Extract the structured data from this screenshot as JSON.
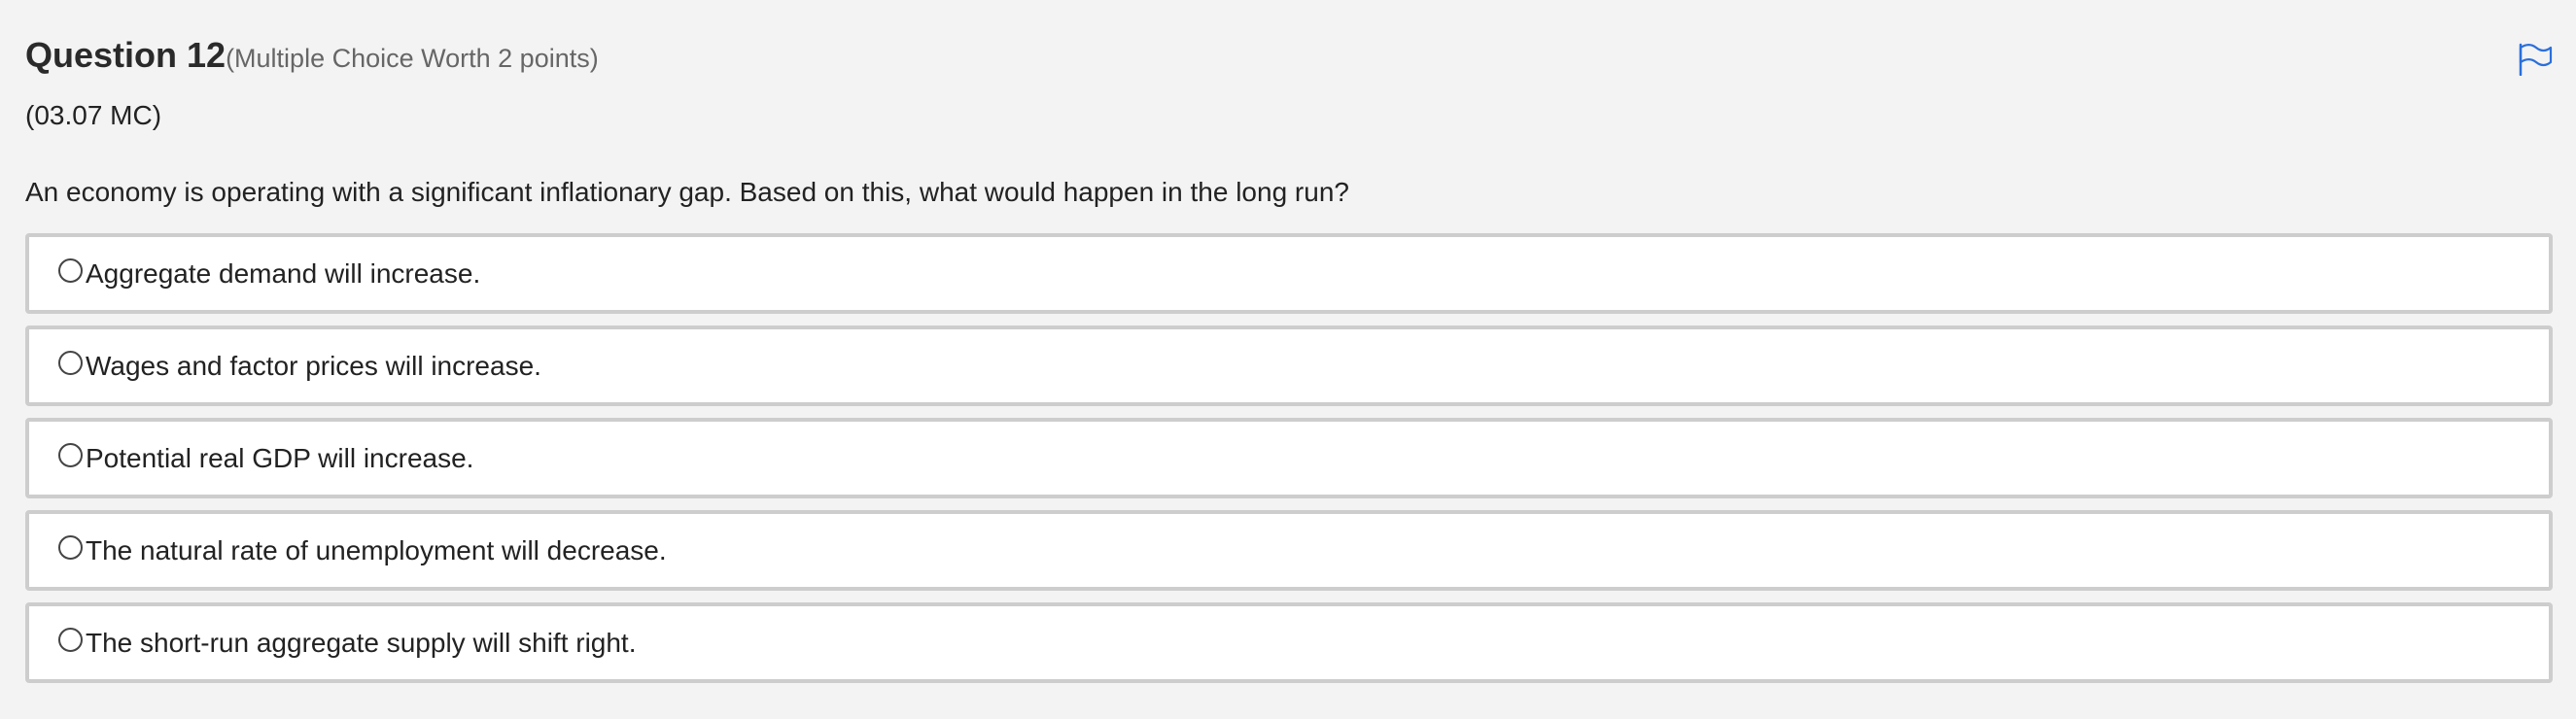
{
  "question": {
    "title": "Question 12",
    "worth": "(Multiple Choice Worth 2 points)",
    "code": "(03.07 MC)",
    "prompt": "An economy is operating with a significant inflationary gap. Based on this, what would happen in the long run?"
  },
  "flag": {
    "icon": "flag-icon",
    "color": "#2a6fdb"
  },
  "options": [
    {
      "label": "Aggregate demand will increase.",
      "selected": false
    },
    {
      "label": "Wages and factor prices will increase.",
      "selected": false
    },
    {
      "label": "Potential real GDP will increase.",
      "selected": false
    },
    {
      "label": "The natural rate of unemployment will decrease.",
      "selected": false
    },
    {
      "label": "The short-run aggregate supply will shift right.",
      "selected": false
    }
  ]
}
